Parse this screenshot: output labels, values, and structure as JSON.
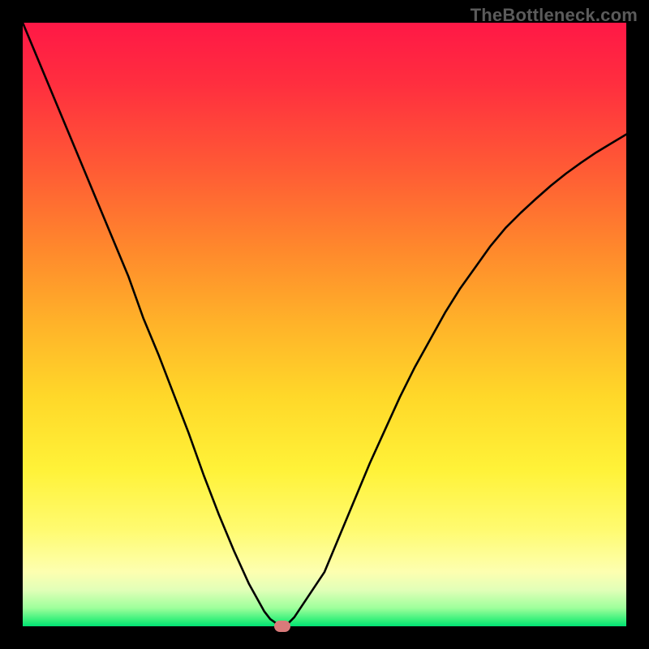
{
  "watermark": "TheBottleneck.com",
  "chart_data": {
    "type": "line",
    "title": "",
    "xlabel": "",
    "ylabel": "",
    "xlim": [
      0,
      100
    ],
    "ylim": [
      0,
      100
    ],
    "grid": false,
    "series": [
      {
        "name": "bottleneck-curve",
        "x": [
          0,
          2.5,
          5,
          7.5,
          10,
          12.5,
          15,
          17.5,
          20,
          22.5,
          25,
          27.5,
          30,
          32.5,
          35,
          37.5,
          40,
          41,
          42,
          44,
          45,
          50,
          52.5,
          55,
          57.5,
          60,
          62.5,
          65,
          67.5,
          70,
          72.5,
          75,
          77.5,
          80,
          82.5,
          85,
          87.5,
          90,
          92.5,
          95,
          97.5,
          100
        ],
        "values": [
          100,
          94,
          88,
          82,
          76,
          70,
          64,
          58,
          51,
          45,
          38.5,
          32,
          25,
          18.5,
          12.5,
          7,
          2.5,
          1.2,
          0.5,
          0.5,
          1.5,
          9,
          15,
          21,
          27,
          32.5,
          38,
          43,
          47.5,
          52,
          56,
          59.5,
          63,
          66,
          68.5,
          70.8,
          73,
          75,
          76.8,
          78.5,
          80,
          81.5
        ]
      }
    ],
    "marker": {
      "x": 43,
      "y": 0,
      "color": "#d97a7a"
    },
    "background_gradient": {
      "type": "vertical",
      "stops": [
        {
          "pos": 0,
          "color": "#ff1846"
        },
        {
          "pos": 50,
          "color": "#ffb329"
        },
        {
          "pos": 85,
          "color": "#fffb70"
        },
        {
          "pos": 100,
          "color": "#00e274"
        }
      ]
    }
  }
}
